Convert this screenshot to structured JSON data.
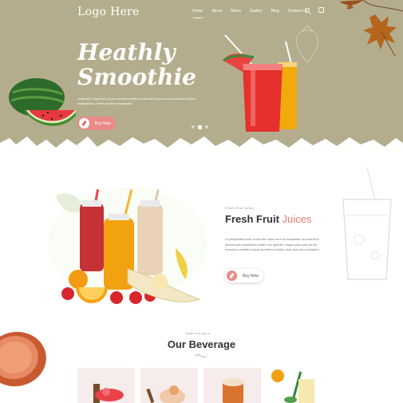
{
  "header": {
    "logo": "Logo Here",
    "nav": [
      "Home",
      "About",
      "Menu",
      "Gallery",
      "Blog",
      "Contact Us"
    ]
  },
  "hero": {
    "title_line1": "Heathly",
    "title_line2": "Smoothie",
    "text": "consectetur. Aliquis sed, do quis ad nostrud ullamco et vel amet tempus ut enim at labore et dolore magna aliqua. Ut enim ad minim consequatur.",
    "buy_label": "Buy Now"
  },
  "fruit_section": {
    "script": "Fresh Fruit Juices",
    "title_main": "Fresh Fruit ",
    "title_accent": "Juices",
    "text": "Ut perspiciatis unde omnis iste natus error sit voluptatem accusantium doloremque laudantium, totam rem aperiam, eaque ipsa quae ab illo inventore veritatis et quasi architecto beatae vitae dicta sunt explicabo.",
    "buy_label": "Buy Now"
  },
  "beverage_section": {
    "script": "Taste Our Juice",
    "title": "Our Beverage"
  },
  "colors": {
    "hero_bg": "#b4ad8d",
    "accent": "#e77c6f",
    "button": "#e98a86"
  },
  "icons": [
    "search-icon",
    "menu-icon",
    "brush-icon",
    "wave-divider-icon"
  ]
}
